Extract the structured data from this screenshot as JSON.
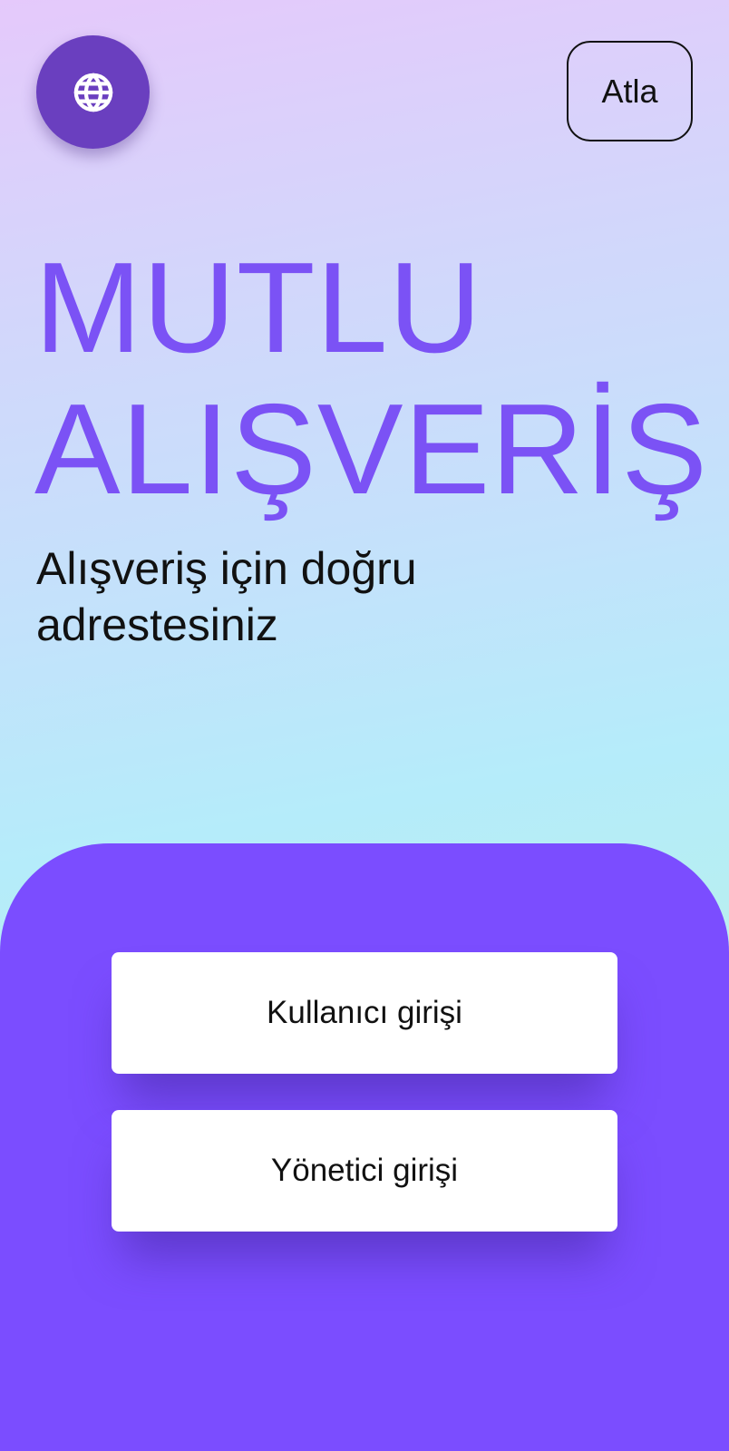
{
  "header": {
    "language_icon": "globe-icon",
    "skip_label": "Atla"
  },
  "hero": {
    "title_line1": "MUTLU",
    "title_line2": "ALIŞVERİŞ",
    "subtitle": "Alışveriş için doğru adrestesiniz"
  },
  "actions": {
    "user_login_label": "Kullanıcı girişi",
    "admin_login_label": "Yönetici girişi"
  },
  "colors": {
    "accent": "#7b52f5",
    "panel": "#7b4dff",
    "language_button": "#6a3fbf"
  }
}
